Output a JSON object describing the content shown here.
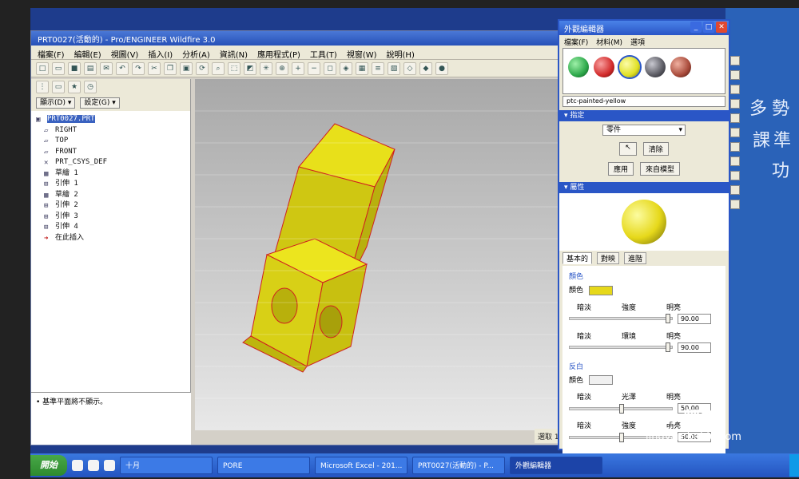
{
  "proe_window": {
    "title": "PRT0027(活動的) - Pro/ENGINEER Wildfire 3.0",
    "menu": [
      "檔案(F)",
      "編輯(E)",
      "視圖(V)",
      "插入(I)",
      "分析(A)",
      "資訊(N)",
      "應用程式(P)",
      "工具(T)",
      "視窗(W)",
      "說明(H)"
    ],
    "panel_dropdowns": {
      "show": "顯示(D) ▾",
      "settings": "設定(G) ▾"
    },
    "tree": [
      "PRT0027.PRT",
      "RIGHT",
      "TOP",
      "FRONT",
      "PRT_CSYS_DEF",
      "草繪 1",
      "引伸 1",
      "草繪 2",
      "引伸 2",
      "引伸 3",
      "引伸 4",
      "在此插入"
    ],
    "status_message": "• 基準平面將不顯示。",
    "select_label": "選取 1"
  },
  "appearance_editor": {
    "title": "外觀編輯器",
    "menu": [
      "檔案(F)",
      "材料(M)",
      "選項"
    ],
    "swatch_colors": [
      "#2da84a",
      "#d22a2a",
      "#e0e024",
      "#5a5a62",
      "#a84a3a"
    ],
    "selected_name": "ptc-painted-yellow",
    "assign_header": "指定",
    "assign_select": "零件",
    "clear_button": "清除",
    "apply_button": "應用",
    "from_model_button": "來自模型",
    "properties_header": "屬性",
    "tabs": [
      "基本的",
      "對映",
      "進階"
    ],
    "color_section": "顏色",
    "color_label": "顏色",
    "color_value_hex": "#e6d81a",
    "label_dark": "暗淡",
    "label_intensity": "強度",
    "label_bright": "明亮",
    "label_ambient": "環境",
    "intensity_value": "90.00",
    "ambient_value": "90.00",
    "highlight_section": "反白",
    "highlight_color_label": "顏色",
    "label_gloss": "光澤",
    "gloss_value": "50.00",
    "highlight_intensity_value": "50.00"
  },
  "taskbar": {
    "start": "開始",
    "tasks": [
      "十月",
      "PORE",
      "Microsoft Excel - 201...",
      "PRT0027(活動的) - P...",
      "外觀編輯器"
    ]
  },
  "watermark": {
    "logo": "Bai 經驗",
    "url": "jingyan.baidu.com"
  },
  "desktop_text": [
    "多",
    "勢",
    "課",
    "準",
    "功"
  ]
}
